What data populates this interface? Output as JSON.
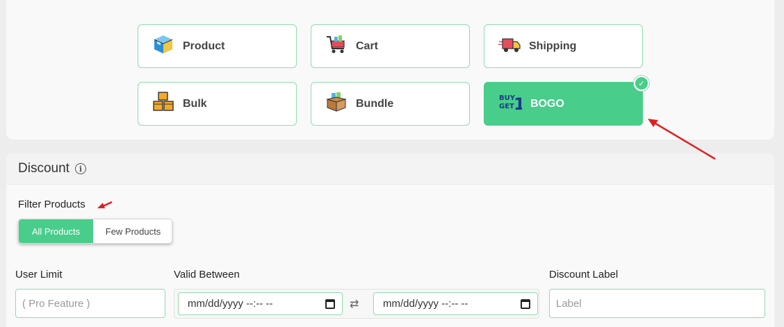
{
  "discount_types": [
    {
      "label": "Product",
      "icon": "product-box-icon",
      "selected": false
    },
    {
      "label": "Cart",
      "icon": "cart-icon",
      "selected": false
    },
    {
      "label": "Shipping",
      "icon": "shipping-truck-icon",
      "selected": false
    },
    {
      "label": "Bulk",
      "icon": "bulk-boxes-icon",
      "selected": false
    },
    {
      "label": "Bundle",
      "icon": "bundle-box-icon",
      "selected": false
    },
    {
      "label": "BOGO",
      "icon": "buy-get-1-icon",
      "selected": true
    }
  ],
  "discount_section": {
    "title": "Discount",
    "filter_label": "Filter Products",
    "filter_options": [
      {
        "label": "All Products",
        "active": true
      },
      {
        "label": "Few Products",
        "active": false
      }
    ],
    "user_limit": {
      "label": "User Limit",
      "placeholder": "( Pro Feature )"
    },
    "valid_between": {
      "label": "Valid Between",
      "start_placeholder": "mm/dd/yyyy --:-- --",
      "end_placeholder": "mm/dd/yyyy --:-- --"
    },
    "discount_label": {
      "label": "Discount Label",
      "placeholder": "Label"
    }
  },
  "colors": {
    "accent": "#48cd8b",
    "border": "#8fdcb0",
    "annotation": "#e02020"
  }
}
